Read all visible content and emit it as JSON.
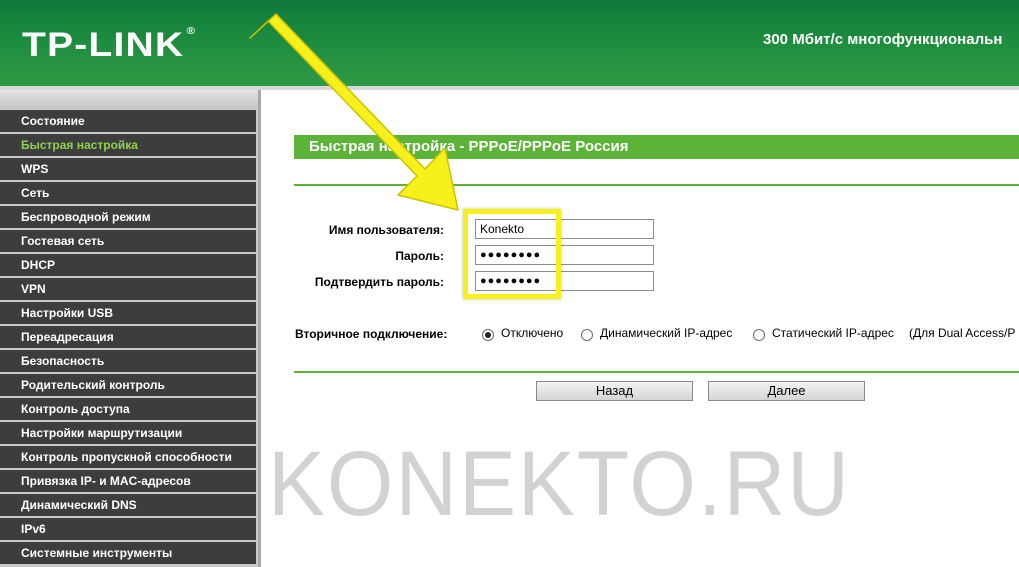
{
  "header": {
    "logo": "TP-LINK",
    "logo_mark": "®",
    "product": "300 Мбит/с многофункциональн"
  },
  "sidebar": {
    "items": [
      {
        "label": "Состояние"
      },
      {
        "label": "Быстрая настройка",
        "active": true
      },
      {
        "label": "WPS"
      },
      {
        "label": "Сеть"
      },
      {
        "label": "Беспроводной режим"
      },
      {
        "label": "Гостевая сеть"
      },
      {
        "label": "DHCP"
      },
      {
        "label": "VPN"
      },
      {
        "label": "Настройки USB"
      },
      {
        "label": "Переадресация"
      },
      {
        "label": "Безопасность"
      },
      {
        "label": "Родительский контроль"
      },
      {
        "label": "Контроль доступа"
      },
      {
        "label": "Настройки маршрутизации"
      },
      {
        "label": "Контроль пропускной способности"
      },
      {
        "label": "Привязка IP- и MAC-адресов"
      },
      {
        "label": "Динамический DNS"
      },
      {
        "label": "IPv6"
      },
      {
        "label": "Системные инструменты"
      }
    ],
    "active_color": "#8fd14f"
  },
  "main": {
    "title": "Быстрая настройка - PPPoE/PPPoE Россия",
    "form": {
      "username_label": "Имя пользователя:",
      "username_value": "Konekto",
      "password_label": "Пароль:",
      "password_value": "●●●●●●●●",
      "confirm_label": "Подтвердить пароль:",
      "confirm_value": "●●●●●●●●"
    },
    "secondary": {
      "label": "Вторичное подключение:",
      "options": [
        {
          "label": "Отключено",
          "checked": true
        },
        {
          "label": "Динамический IP-адрес",
          "checked": false
        },
        {
          "label": "Статический IP-адрес",
          "checked": false
        }
      ],
      "note": "(Для Dual Access/P"
    },
    "buttons": {
      "back": "Назад",
      "next": "Далее"
    }
  },
  "watermark": "KONEKTO.RU",
  "colors": {
    "header_green": "#1f8f3f",
    "title_green": "#5cb338",
    "menu_bg": "#3d3d3d",
    "highlight_yellow": "#f7f01a"
  }
}
